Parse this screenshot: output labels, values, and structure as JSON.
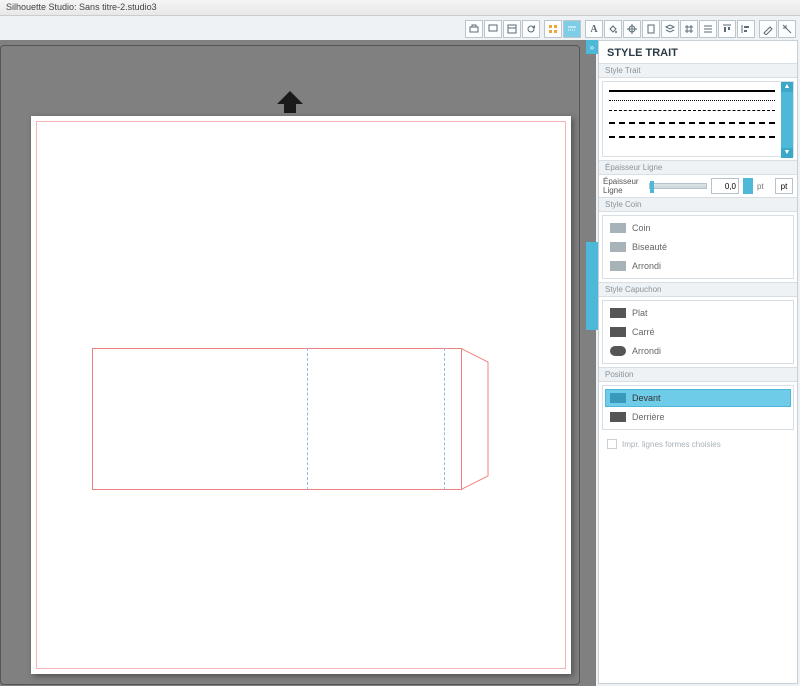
{
  "titlebar": "Silhouette Studio: Sans titre-2.studio3",
  "panel": {
    "title": "STYLE TRAIT",
    "sections": {
      "styleTrait": "Style Trait",
      "thickness": {
        "hdr": "Épaisseur Ligne",
        "label": "Épaisseur Ligne",
        "value": "0,0",
        "unit": "pt",
        "btn": "pt"
      },
      "corner": {
        "hdr": "Style Coin",
        "opts": [
          "Coin",
          "Biseauté",
          "Arrondi"
        ]
      },
      "cap": {
        "hdr": "Style Capuchon",
        "opts": [
          "Plat",
          "Carré",
          "Arrondi"
        ]
      },
      "position": {
        "hdr": "Position",
        "opts": [
          "Devant",
          "Derrière"
        ],
        "selected": 0
      },
      "printLines": "Impr. lignes formes choisies"
    }
  },
  "toolbar_icons": [
    "printer",
    "monitor",
    "window",
    "refresh",
    "grid",
    "lines-h",
    "text",
    "paint",
    "crosshair",
    "page",
    "stack",
    "grid2",
    "blinds",
    "align-top",
    "align-left",
    "pencil",
    "crop"
  ]
}
